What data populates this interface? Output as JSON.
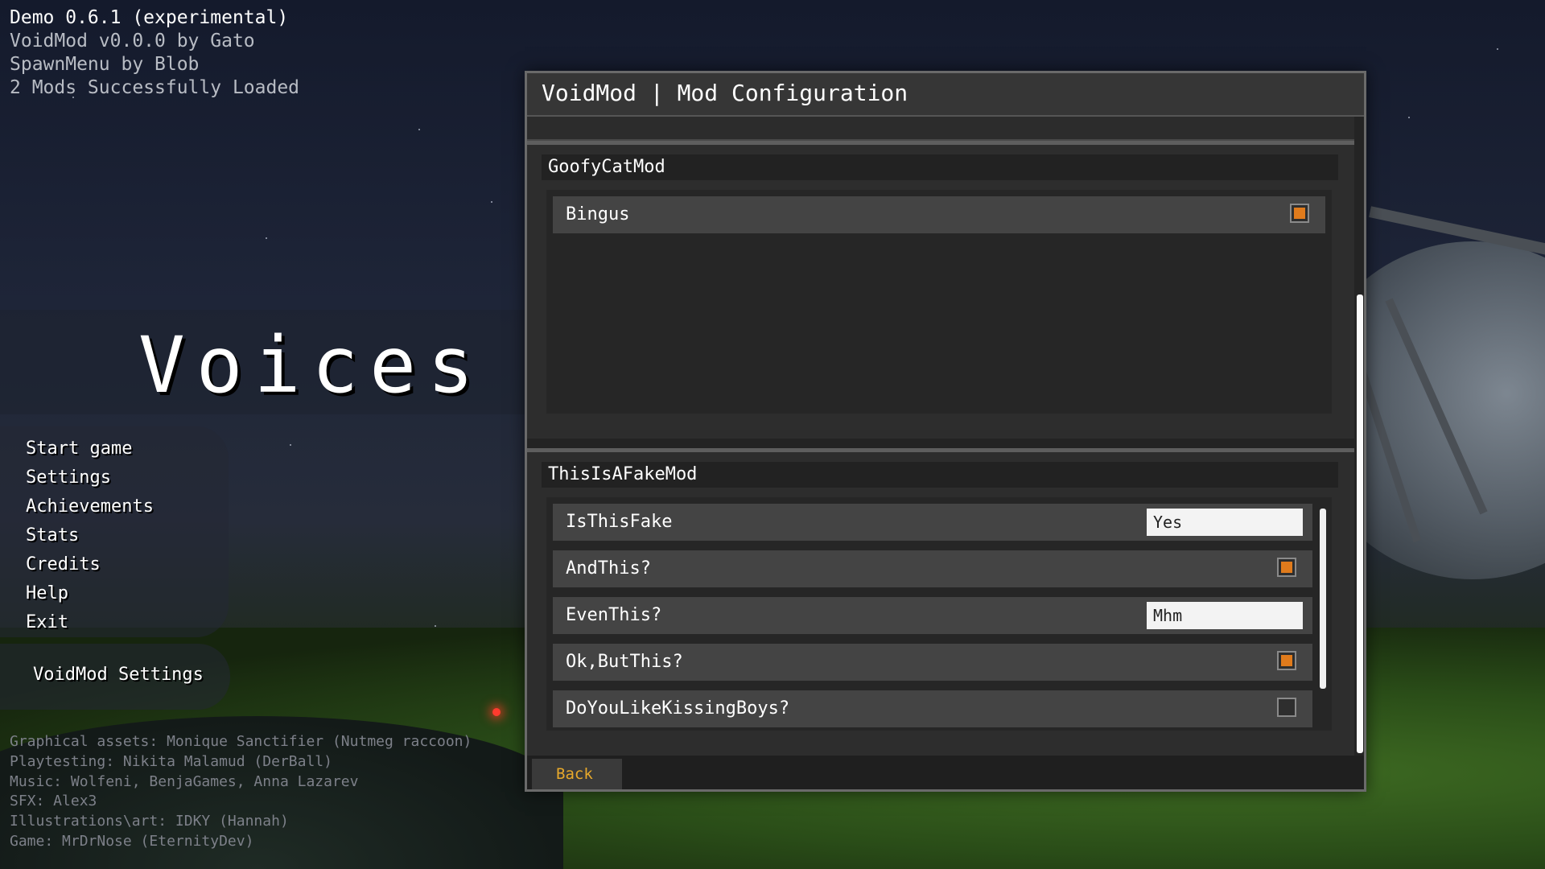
{
  "hud": {
    "version": "Demo 0.6.1 (experimental)",
    "modloader": "VoidMod v0.0.0 by Gato",
    "spawnmenu": "SpawnMenu by Blob",
    "mods_loaded": "2 Mods Successfully Loaded"
  },
  "game_title": "Voices Of",
  "main_menu": {
    "items": [
      "Start game",
      "Settings",
      "Achievements",
      "Stats",
      "Credits",
      "Help",
      "Exit"
    ],
    "voidmod_settings": "VoidMod Settings"
  },
  "credits": [
    "Graphical assets: Monique Sanctifier (Nutmeg raccoon)",
    "Playtesting: Nikita Malamud (DerBall)",
    "Music: Wolfeni, BenjaGames, Anna Lazarev",
    "SFX: Alex3",
    "Illustrations\\art: IDKY (Hannah)",
    "Game: MrDrNose (EternityDev)"
  ],
  "config_window": {
    "title": "VoidMod | Mod Configuration",
    "mods": [
      {
        "name": "GoofyCatMod",
        "options": [
          {
            "label": "Bingus",
            "type": "checkbox",
            "checked": true
          }
        ]
      },
      {
        "name": "ThisIsAFakeMod",
        "options": [
          {
            "label": "IsThisFake",
            "type": "text",
            "value": "Yes"
          },
          {
            "label": "AndThis?",
            "type": "checkbox",
            "checked": true
          },
          {
            "label": "EvenThis?",
            "type": "text",
            "value": "Mhm"
          },
          {
            "label": "Ok,ButThis?",
            "type": "checkbox",
            "checked": true
          },
          {
            "label": "DoYouLikeKissingBoys?",
            "type": "checkbox",
            "checked": false
          }
        ]
      }
    ],
    "back_label": "Back"
  },
  "colors": {
    "accent_checkbox": "#e07b1c",
    "back_text": "#e7a82b"
  }
}
